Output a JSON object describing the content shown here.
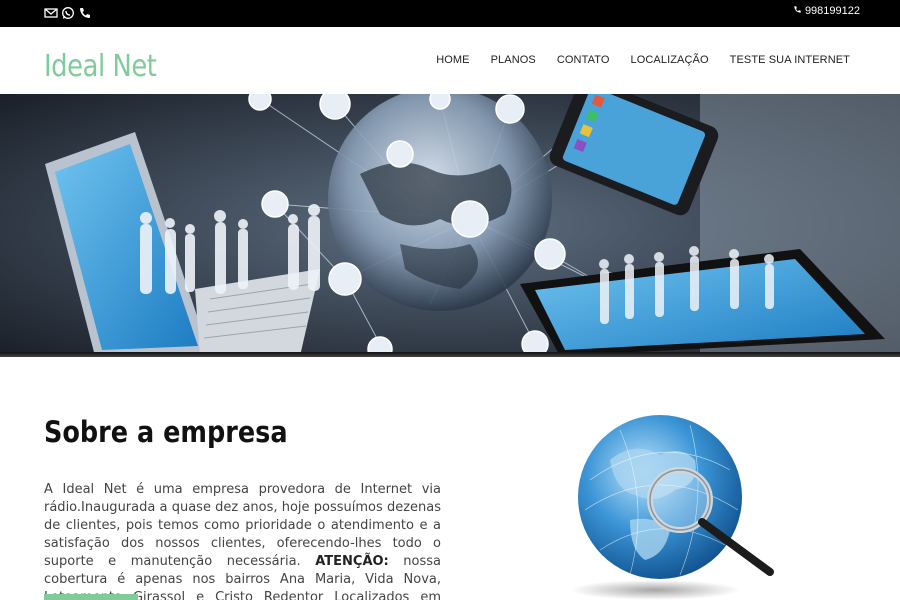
{
  "topbar": {
    "icons": [
      "envelope-icon",
      "whatsapp-icon",
      "phone-icon"
    ],
    "phone_number": "998199122"
  },
  "header": {
    "logo": "Ideal Net",
    "nav": [
      "HOME",
      "PLANOS",
      "CONTATO",
      "LOCALIZAÇÃO",
      "TESTE SUA INTERNET"
    ]
  },
  "about": {
    "title": "Sobre a empresa",
    "text_main": "A Ideal Net é uma empresa provedora de Internet via rádio.Inaugurada a quase dez anos, hoje possuímos dezenas de clientes, pois temos como prioridade o atendimento e a satisfação dos nossos clientes, oferecendo-lhes todo o suporte e manutenção necessária.",
    "text_warning_label": "ATENÇÃO:",
    "text_warning": "nossa cobertura é apenas nos bairros Ana Maria, Vida Nova, Loteamento Girassol e Cristo Redentor Localizados em criciúma."
  },
  "colors": {
    "brand_green": "#7fcb9a",
    "topbar": "#000000"
  }
}
